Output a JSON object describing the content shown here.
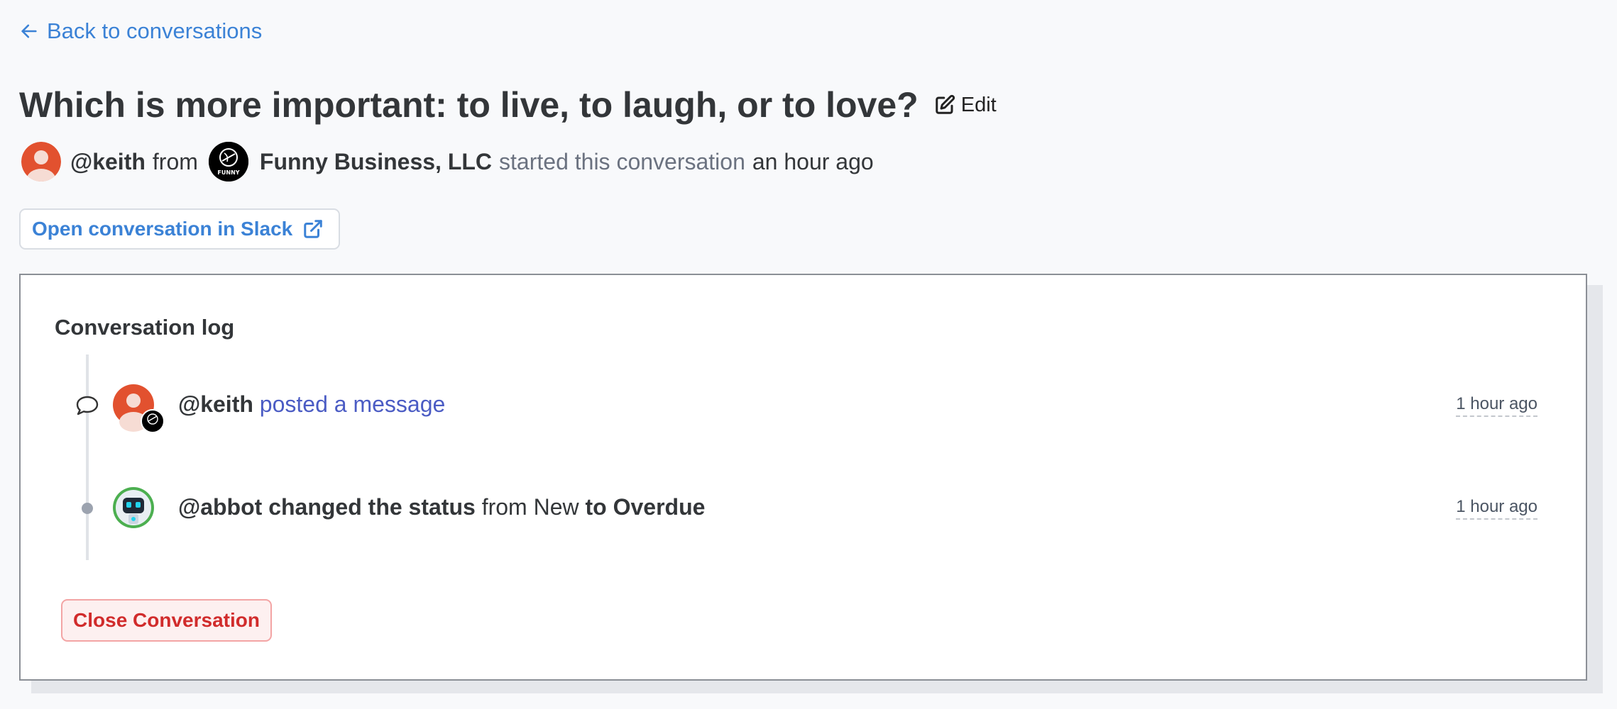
{
  "nav": {
    "back_label": "Back to conversations",
    "back_icon": "arrow-left-icon"
  },
  "conversation": {
    "title": "Which is more important: to live, to laugh, or to love?",
    "edit_label": "Edit",
    "author": "@keith",
    "from_text": "from",
    "organization": "Funny Business, LLC",
    "started_text": "started this conversation",
    "started_time": "an hour ago",
    "org_logo_text": "FUNNY"
  },
  "actions": {
    "open_slack_label": "Open conversation in Slack",
    "close_label": "Close Conversation"
  },
  "log": {
    "heading": "Conversation log",
    "items": [
      {
        "actor": "@keith",
        "action": "posted a message",
        "time": "1 hour ago",
        "icon": "speech-bubble-icon"
      },
      {
        "actor": "@abbot",
        "action": "changed the status",
        "from_word": "from",
        "from_status": "New",
        "to_text": "to Overdue",
        "time": "1 hour ago",
        "icon": "dot-icon"
      }
    ]
  },
  "colors": {
    "accent": "#3b82d6",
    "danger": "#d12c2c",
    "avatar_orange": "#e2512f",
    "bot_green": "#4caf50"
  }
}
